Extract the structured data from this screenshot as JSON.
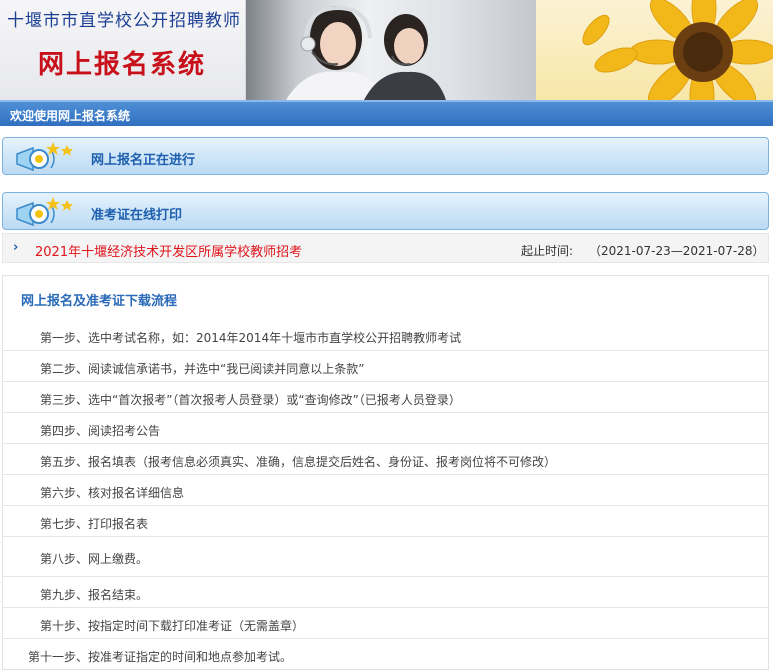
{
  "banner": {
    "subtitle": "十堰市市直学校公开招聘教师",
    "title": "网上报名系统"
  },
  "welcome": "欢迎使用网上报名系统",
  "buttons": {
    "registration": "网上报名正在进行",
    "admission_ticket": "准考证在线打印"
  },
  "exam": {
    "bullet": "›",
    "title": "2021年十堰经济技术开发区所属学校教师招考",
    "deadline_label": "起止时间:",
    "deadline_value": "（2021-07-23—2021-07-28）"
  },
  "process": {
    "title": "网上报名及准考证下载流程",
    "steps": [
      "第一步、选中考试名称，如：2014年2014年十堰市市直学校公开招聘教师考试",
      "第二步、阅读诚信承诺书，并选中“我已阅读并同意以上条款”",
      "第三步、选中“首次报考”（首次报考人员登录）或“查询修改”（已报考人员登录）",
      "第四步、阅读招考公告",
      "第五步、报名填表（报考信息必须真实、准确，信息提交后姓名、身份证、报考岗位将不可修改）",
      "第六步、核对报名详细信息",
      "第七步、打印报名表",
      "第八步、网上缴费。",
      "第九步、报名结束。",
      "第十步、按指定时间下载打印准考证（无需盖章）",
      "第十一步、按准考证指定的时间和地点参加考试。"
    ]
  },
  "colors": {
    "accent_blue": "#2f6fbf",
    "title_red": "#c8101a",
    "link_red": "#e0141b"
  }
}
